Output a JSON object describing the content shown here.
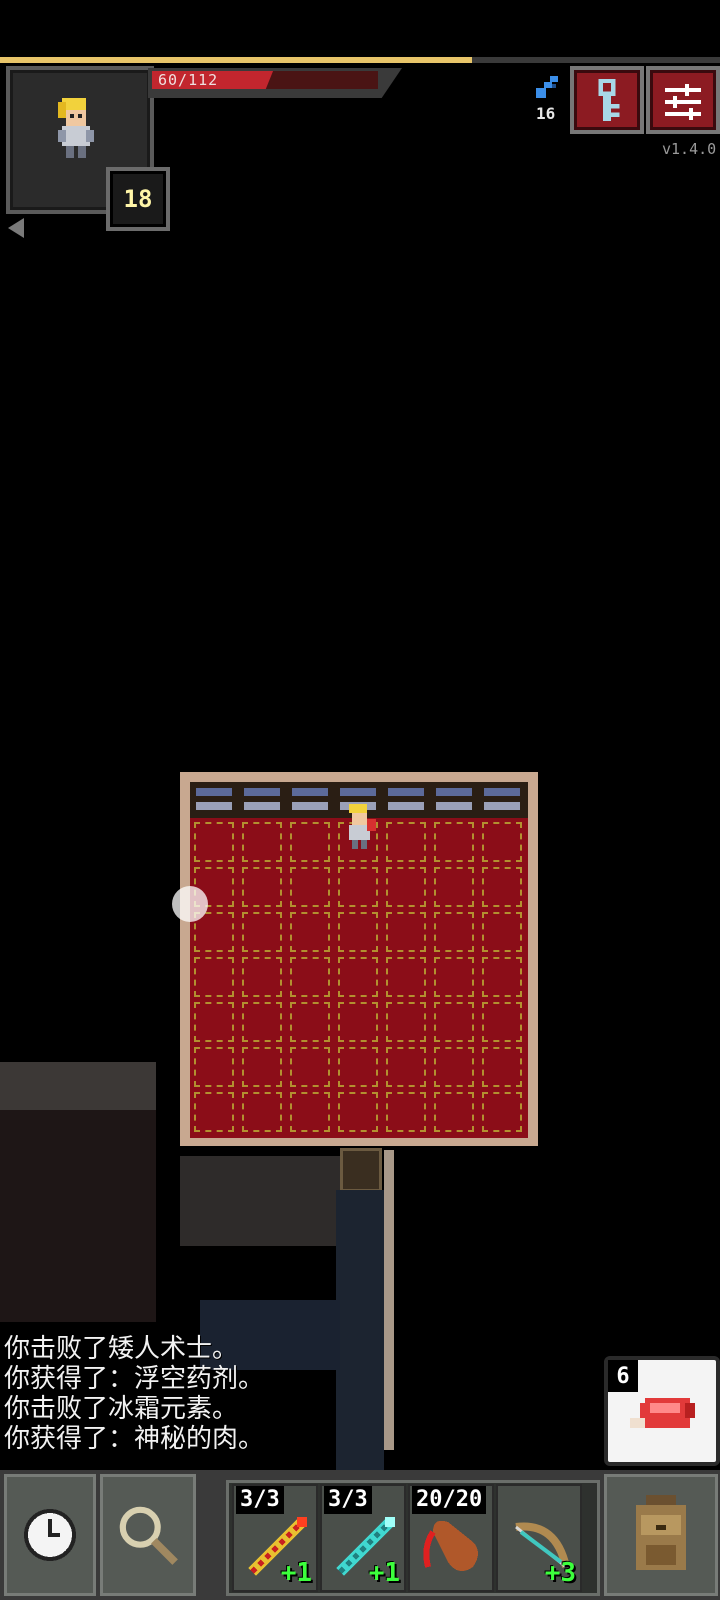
{
  "status": {
    "hp_current": 60,
    "hp_max": 112,
    "hp_text": "60/112",
    "xp_fraction": 0.655,
    "level": "18",
    "depth": "16",
    "version": "v1.4.0"
  },
  "buttons": {
    "journal_icon": "key-icon",
    "menu_icon": "menu-icon"
  },
  "message_log": [
    "你击败了矮人术士。",
    "你获得了：浮空药剂。",
    "你击败了冰霜元素。",
    "你获得了：神秘的肉。"
  ],
  "quick_item": {
    "count": "6",
    "icon": "meat-icon"
  },
  "quickslots": [
    {
      "charges": "3/3",
      "upgrade": "+1",
      "icon": "fire-wand-icon"
    },
    {
      "charges": "3/3",
      "upgrade": "+1",
      "icon": "frost-wand-icon"
    },
    {
      "charges": "20/20",
      "upgrade": "",
      "icon": "hunting-horn-icon"
    },
    {
      "charges": "",
      "upgrade": "+3",
      "icon": "bow-icon"
    }
  ],
  "colors": {
    "hp": "#c2262e",
    "xp": "#e8c56a",
    "carpet": "#8b0d18",
    "upgrade": "#3cff3c"
  }
}
